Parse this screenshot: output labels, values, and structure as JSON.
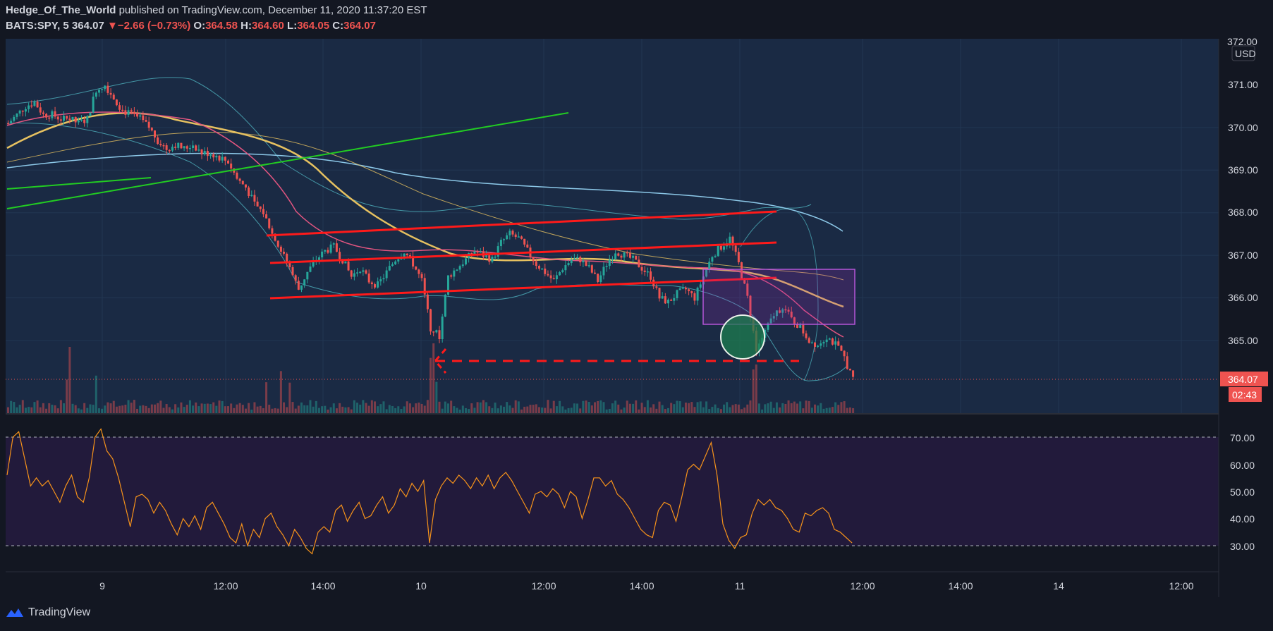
{
  "header": {
    "author": "Hedge_Of_The_World",
    "published": "published on TradingView.com, December 11, 2020 11:37:20 EST",
    "symbol": "BATS:SPY, 5",
    "last": "364.07",
    "change": "−2.66 (−0.73%)",
    "o_label": "O:",
    "o": "364.58",
    "h_label": "H:",
    "h": "364.60",
    "l_label": "L:",
    "l": "364.05",
    "c_label": "C:",
    "c": "364.07"
  },
  "price_scale": {
    "currency": "USD",
    "ticks": [
      "371.00",
      "370.00",
      "369.00",
      "368.00",
      "367.00",
      "366.00",
      "365.00"
    ],
    "top_tick": "372.00",
    "last_price": "364.07",
    "countdown": "02:43"
  },
  "rsi_scale": {
    "ticks": [
      "70.00",
      "60.00",
      "50.00",
      "40.00",
      "30.00"
    ]
  },
  "time_axis": {
    "labels": [
      "9",
      "12:00",
      "14:00",
      "10",
      "12:00",
      "14:00",
      "11",
      "12:00",
      "14:00",
      "14",
      "12:00"
    ]
  },
  "brand": {
    "name": "TradingView"
  },
  "colors": {
    "background": "#131722",
    "pane": "#1a2a44",
    "rsi_band": "#221a3b",
    "up": "#26a69a",
    "down": "#ef5350",
    "trend_red": "#ff1a1a",
    "trend_green": "#22cc22",
    "ma_yellow": "#e6c160",
    "ma_blue": "#8cc8e8",
    "rsi_line": "#f7931a",
    "box": "#9c27b0"
  },
  "chart_data": {
    "type": "candlestick",
    "price_pane": {
      "ylim": [
        364.0,
        372.0
      ],
      "close_path": [
        [
          0,
          370.1
        ],
        [
          3,
          370.3
        ],
        [
          6,
          370.5
        ],
        [
          9,
          370.6
        ],
        [
          12,
          370.3
        ],
        [
          15,
          370.3
        ],
        [
          18,
          370.2
        ],
        [
          21,
          370.2
        ],
        [
          24,
          370.1
        ],
        [
          27,
          370.2
        ],
        [
          30,
          370.9
        ],
        [
          33,
          371.0
        ],
        [
          36,
          370.7
        ],
        [
          39,
          370.4
        ],
        [
          42,
          370.3
        ],
        [
          45,
          370.2
        ],
        [
          48,
          370.0
        ],
        [
          51,
          369.7
        ],
        [
          54,
          369.5
        ],
        [
          57,
          369.6
        ],
        [
          60,
          369.5
        ],
        [
          63,
          369.6
        ],
        [
          66,
          369.4
        ],
        [
          69,
          369.4
        ],
        [
          72,
          369.3
        ],
        [
          75,
          369.2
        ],
        [
          78,
          368.8
        ],
        [
          81,
          368.6
        ],
        [
          84,
          368.2
        ],
        [
          87,
          368.0
        ],
        [
          90,
          367.5
        ],
        [
          93,
          367.1
        ],
        [
          96,
          366.7
        ],
        [
          99,
          366.2
        ],
        [
          102,
          366.6
        ],
        [
          105,
          366.9
        ],
        [
          108,
          367.1
        ],
        [
          111,
          367.2
        ],
        [
          114,
          366.9
        ],
        [
          117,
          366.5
        ],
        [
          120,
          366.7
        ],
        [
          123,
          366.4
        ],
        [
          126,
          366.3
        ],
        [
          129,
          366.6
        ],
        [
          132,
          366.9
        ],
        [
          135,
          367.1
        ],
        [
          138,
          366.8
        ],
        [
          141,
          366.4
        ],
        [
          144,
          365.3
        ],
        [
          147,
          365.1
        ],
        [
          150,
          366.5
        ],
        [
          153,
          366.7
        ],
        [
          156,
          366.9
        ],
        [
          159,
          367.1
        ],
        [
          162,
          367.0
        ],
        [
          165,
          366.9
        ],
        [
          168,
          367.3
        ],
        [
          171,
          367.5
        ],
        [
          174,
          367.4
        ],
        [
          177,
          367.1
        ],
        [
          180,
          366.8
        ],
        [
          183,
          366.6
        ],
        [
          186,
          366.4
        ],
        [
          189,
          366.7
        ],
        [
          192,
          366.9
        ],
        [
          195,
          366.9
        ],
        [
          198,
          366.7
        ],
        [
          201,
          366.4
        ],
        [
          204,
          366.8
        ],
        [
          207,
          367.1
        ],
        [
          210,
          367.0
        ],
        [
          213,
          366.9
        ],
        [
          216,
          366.7
        ],
        [
          219,
          366.5
        ],
        [
          222,
          366.0
        ],
        [
          225,
          365.9
        ],
        [
          228,
          366.1
        ],
        [
          231,
          366.2
        ],
        [
          234,
          366.0
        ],
        [
          237,
          366.5
        ],
        [
          240,
          367.0
        ],
        [
          243,
          367.2
        ],
        [
          246,
          367.4
        ],
        [
          249,
          366.8
        ],
        [
          252,
          366.0
        ],
        [
          255,
          364.8
        ],
        [
          258,
          365.2
        ],
        [
          261,
          365.6
        ],
        [
          264,
          365.8
        ],
        [
          267,
          365.5
        ],
        [
          270,
          365.3
        ],
        [
          273,
          365.0
        ],
        [
          276,
          364.9
        ],
        [
          279,
          365.1
        ],
        [
          282,
          364.9
        ],
        [
          285,
          364.6
        ],
        [
          288,
          364.07
        ]
      ]
    },
    "rsi_pane": {
      "ylim": [
        25,
        75
      ],
      "upper": 70,
      "lower": 30,
      "values": [
        [
          0,
          56
        ],
        [
          2,
          70
        ],
        [
          4,
          72
        ],
        [
          6,
          62
        ],
        [
          8,
          52
        ],
        [
          10,
          55
        ],
        [
          12,
          52
        ],
        [
          14,
          54
        ],
        [
          16,
          50
        ],
        [
          18,
          46
        ],
        [
          20,
          52
        ],
        [
          22,
          56
        ],
        [
          24,
          48
        ],
        [
          26,
          46
        ],
        [
          28,
          55
        ],
        [
          30,
          70
        ],
        [
          32,
          73
        ],
        [
          34,
          65
        ],
        [
          36,
          62
        ],
        [
          38,
          55
        ],
        [
          40,
          46
        ],
        [
          42,
          37
        ],
        [
          44,
          48
        ],
        [
          46,
          49
        ],
        [
          48,
          47
        ],
        [
          50,
          42
        ],
        [
          52,
          46
        ],
        [
          54,
          43
        ],
        [
          56,
          38
        ],
        [
          58,
          34
        ],
        [
          60,
          40
        ],
        [
          62,
          37
        ],
        [
          64,
          41
        ],
        [
          66,
          36
        ],
        [
          68,
          44
        ],
        [
          70,
          46
        ],
        [
          72,
          42
        ],
        [
          74,
          38
        ],
        [
          76,
          33
        ],
        [
          78,
          31
        ],
        [
          80,
          38
        ],
        [
          82,
          30
        ],
        [
          84,
          36
        ],
        [
          86,
          33
        ],
        [
          88,
          40
        ],
        [
          90,
          42
        ],
        [
          92,
          37
        ],
        [
          94,
          34
        ],
        [
          96,
          30
        ],
        [
          98,
          36
        ],
        [
          100,
          33
        ],
        [
          102,
          29
        ],
        [
          104,
          27
        ],
        [
          106,
          35
        ],
        [
          108,
          37
        ],
        [
          110,
          35
        ],
        [
          112,
          43
        ],
        [
          114,
          45
        ],
        [
          116,
          39
        ],
        [
          118,
          43
        ],
        [
          120,
          46
        ],
        [
          122,
          40
        ],
        [
          124,
          41
        ],
        [
          126,
          45
        ],
        [
          128,
          48
        ],
        [
          130,
          42
        ],
        [
          132,
          45
        ],
        [
          134,
          51
        ],
        [
          136,
          48
        ],
        [
          138,
          53
        ],
        [
          140,
          50
        ],
        [
          142,
          54
        ],
        [
          144,
          31
        ],
        [
          146,
          47
        ],
        [
          148,
          52
        ],
        [
          150,
          55
        ],
        [
          152,
          53
        ],
        [
          154,
          56
        ],
        [
          156,
          54
        ],
        [
          158,
          51
        ],
        [
          160,
          55
        ],
        [
          162,
          52
        ],
        [
          164,
          56
        ],
        [
          166,
          51
        ],
        [
          168,
          55
        ],
        [
          170,
          57
        ],
        [
          172,
          54
        ],
        [
          174,
          50
        ],
        [
          176,
          46
        ],
        [
          178,
          42
        ],
        [
          180,
          49
        ],
        [
          182,
          50
        ],
        [
          184,
          48
        ],
        [
          186,
          51
        ],
        [
          188,
          49
        ],
        [
          190,
          44
        ],
        [
          192,
          50
        ],
        [
          194,
          48
        ],
        [
          196,
          40
        ],
        [
          198,
          47
        ],
        [
          200,
          55
        ],
        [
          202,
          55
        ],
        [
          204,
          52
        ],
        [
          206,
          54
        ],
        [
          208,
          49
        ],
        [
          210,
          47
        ],
        [
          212,
          44
        ],
        [
          214,
          40
        ],
        [
          216,
          36
        ],
        [
          218,
          34
        ],
        [
          220,
          33
        ],
        [
          222,
          43
        ],
        [
          224,
          46
        ],
        [
          226,
          45
        ],
        [
          228,
          39
        ],
        [
          230,
          48
        ],
        [
          232,
          58
        ],
        [
          234,
          60
        ],
        [
          236,
          58
        ],
        [
          238,
          63
        ],
        [
          240,
          68
        ],
        [
          242,
          56
        ],
        [
          244,
          38
        ],
        [
          246,
          32
        ],
        [
          248,
          29
        ],
        [
          250,
          33
        ],
        [
          252,
          34
        ],
        [
          254,
          42
        ],
        [
          256,
          47
        ],
        [
          258,
          45
        ],
        [
          260,
          47
        ],
        [
          262,
          44
        ],
        [
          264,
          43
        ],
        [
          266,
          40
        ],
        [
          268,
          36
        ],
        [
          270,
          35
        ],
        [
          272,
          42
        ],
        [
          274,
          41
        ],
        [
          276,
          43
        ],
        [
          278,
          44
        ],
        [
          280,
          42
        ],
        [
          282,
          36
        ],
        [
          284,
          35
        ],
        [
          286,
          33
        ],
        [
          288,
          31
        ]
      ]
    }
  }
}
